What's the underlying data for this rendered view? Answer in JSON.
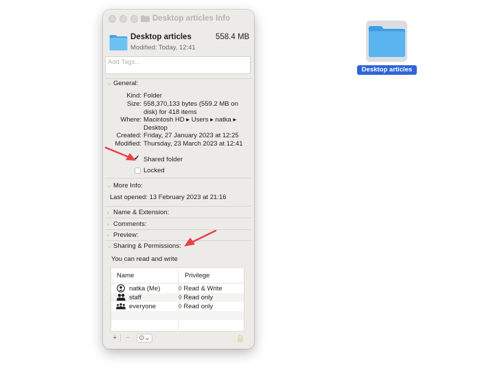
{
  "window": {
    "title": "Desktop articles Info"
  },
  "header": {
    "name": "Desktop articles",
    "size": "558.4 MB",
    "modified": "Modified: Today, 12:41"
  },
  "tags": {
    "placeholder": "Add Tags..."
  },
  "general": {
    "heading": "General:",
    "kind_label": "Kind:",
    "kind_value": "Folder",
    "size_label": "Size:",
    "size_value": "558,370,133 bytes (559.2 MB on disk) for 418 items",
    "where_label": "Where:",
    "where_value": "Macintosh HD ▸ Users ▸ natka ▸ Desktop",
    "created_label": "Created:",
    "created_value": "Friday, 27 January 2023 at 12:25",
    "modified_label": "Modified:",
    "modified_value": "Thursday, 23 March 2023 at 12:41",
    "shared_folder_label": "Shared folder",
    "shared_folder_checked": true,
    "locked_label": "Locked",
    "locked_checked": false
  },
  "more_info": {
    "heading": "More Info:",
    "last_opened": "Last opened: 13 February 2023 at 21:16"
  },
  "collapsed_sections": {
    "name_extension": "Name & Extension:",
    "comments": "Comments:",
    "preview": "Preview:"
  },
  "sharing": {
    "heading": "Sharing & Permissions:",
    "summary": "You can read and write",
    "col_name": "Name",
    "col_privilege": "Privilege",
    "rows": [
      {
        "name": "natka (Me)",
        "privilege": "Read & Write",
        "icon": "person-circle-icon"
      },
      {
        "name": "staff",
        "privilege": "Read only",
        "icon": "group-icon"
      },
      {
        "name": "everyone",
        "privilege": "Read only",
        "icon": "everyone-icon"
      }
    ],
    "stepper_glyph": "◊"
  },
  "toolbar": {
    "add": "+",
    "remove": "−",
    "action": "⊙⌄"
  },
  "desktop": {
    "folder_label": "Desktop articles"
  },
  "colors": {
    "window_bg": "#ecebe8",
    "folder_blue": "#5ab4ef",
    "selection_blue": "#2f64d9",
    "arrow_red": "#e8404a"
  }
}
